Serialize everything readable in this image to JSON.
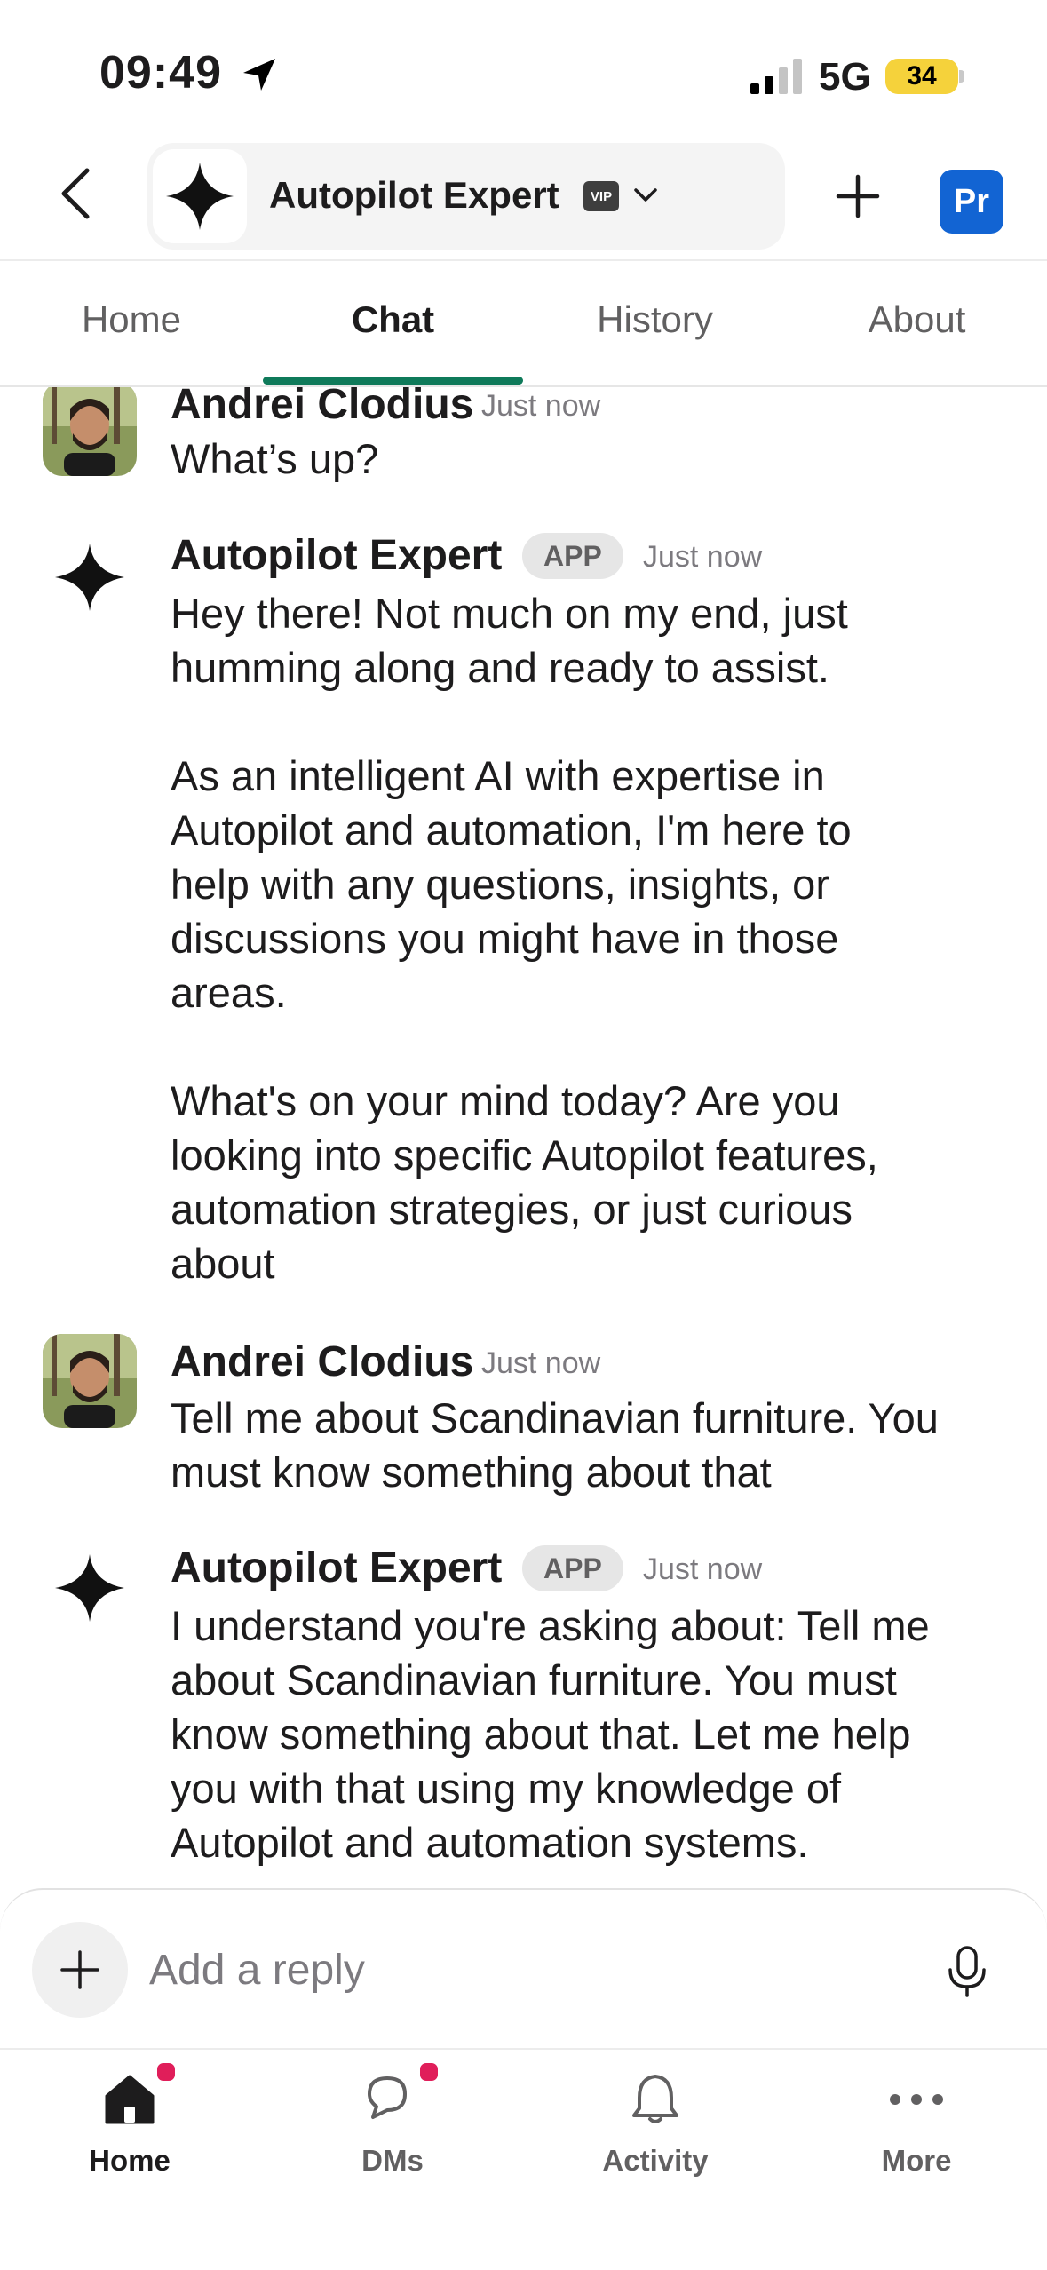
{
  "status_bar": {
    "time": "09:49",
    "network": "5G",
    "battery": "34",
    "icons": [
      "location-arrow-icon",
      "signal-bars-icon"
    ]
  },
  "header": {
    "channel_name": "Autopilot Expert",
    "vip_badge": "VIP",
    "profile_initials": "Pr",
    "accent_color": "#1264d3"
  },
  "tabs": [
    {
      "label": "Home"
    },
    {
      "label": "Chat",
      "active": true
    },
    {
      "label": "History"
    },
    {
      "label": "About"
    }
  ],
  "tab_accent_color": "#0f7a5a",
  "messages": [
    {
      "author": "Andrei Clodius",
      "time": "Just now",
      "text": "What’s up?"
    },
    {
      "author": "Autopilot Expert",
      "badge": "APP",
      "time": "Just now",
      "text": "Hey there! Not much on my end, just\nhumming along and ready to assist.\n\nAs an intelligent AI with expertise in\nAutopilot and automation, I'm here to\nhelp with any questions, insights, or\ndiscussions you might have in those\nareas.\n\nWhat's on your mind today? Are you\nlooking into specific Autopilot features,\nautomation strategies, or just curious\nabout"
    },
    {
      "author": "Andrei Clodius",
      "time": "Just now",
      "text": "Tell me about Scandinavian furniture. You\nmust know something about that"
    },
    {
      "author": "Autopilot Expert",
      "badge": "APP",
      "time": "Just now",
      "text": "I understand you're asking about: Tell me\nabout Scandinavian furniture. You must\nknow something about that. Let me help\nyou with that using my knowledge of\nAutopilot and automation systems."
    }
  ],
  "composer": {
    "placeholder": "Add a reply"
  },
  "bottom_nav": [
    {
      "label": "Home",
      "icon": "home-icon",
      "active": true,
      "notification": true
    },
    {
      "label": "DMs",
      "icon": "dms-icon",
      "notification": true
    },
    {
      "label": "Activity",
      "icon": "bell-icon"
    },
    {
      "label": "More",
      "icon": "more-icon"
    }
  ],
  "notification_color": "#e01e5a"
}
